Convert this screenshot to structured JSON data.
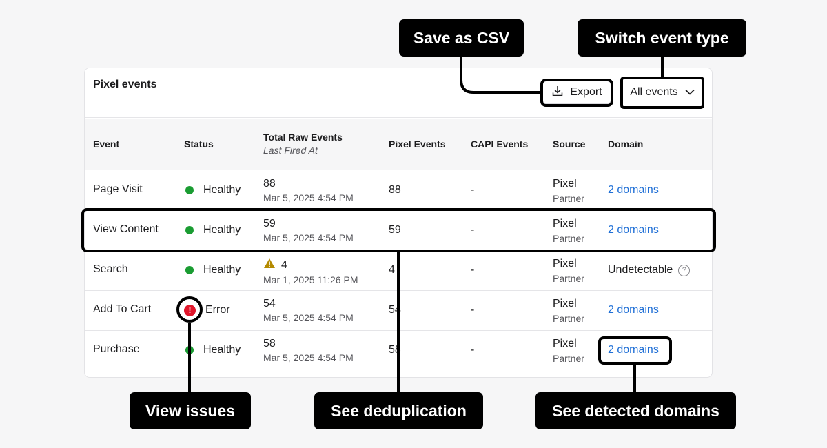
{
  "card": {
    "title": "Pixel events",
    "export_label": "Export",
    "filter_label": "All events"
  },
  "columns": {
    "event": "Event",
    "status": "Status",
    "raw": "Total Raw Events",
    "raw_sub": "Last Fired At",
    "pixel": "Pixel Events",
    "capi": "CAPI Events",
    "source": "Source",
    "domain": "Domain"
  },
  "rows": [
    {
      "event": "Page Visit",
      "status": "Healthy",
      "raw": "88",
      "date": "Mar 5, 2025 4:54 PM",
      "pixel": "88",
      "capi": "-",
      "source": "Pixel",
      "partner": "Partner",
      "domain": "2 domains"
    },
    {
      "event": "View Content",
      "status": "Healthy",
      "raw": "59",
      "date": "Mar 5, 2025 4:54 PM",
      "pixel": "59",
      "capi": "-",
      "source": "Pixel",
      "partner": "Partner",
      "domain": "2 domains"
    },
    {
      "event": "Search",
      "status": "Healthy",
      "raw": "4",
      "date": "Mar 1, 2025 11:26 PM",
      "pixel": "4",
      "capi": "-",
      "source": "Pixel",
      "partner": "Partner",
      "domain": "Undetectable"
    },
    {
      "event": "Add To Cart",
      "status": "Error",
      "raw": "54",
      "date": "Mar 5, 2025 4:54 PM",
      "pixel": "54",
      "capi": "-",
      "source": "Pixel",
      "partner": "Partner",
      "domain": "2 domains"
    },
    {
      "event": "Purchase",
      "status": "Healthy",
      "raw": "58",
      "date": "Mar 5, 2025 4:54 PM",
      "pixel": "58",
      "capi": "-",
      "source": "Pixel",
      "partner": "Partner",
      "domain": "2 domains"
    }
  ],
  "annotations": {
    "save_csv": "Save as CSV",
    "switch_event": "Switch event type",
    "view_issues": "View issues",
    "see_dedup": "See deduplication",
    "see_domains": "See detected domains"
  },
  "colors": {
    "healthy": "#1a9c32",
    "error": "#e0162b",
    "warning": "#b48a00",
    "link": "#1f6fd6"
  },
  "icons": {
    "export": "download-icon",
    "filter": "chevron-down-icon",
    "healthy": "status-dot-icon",
    "error": "error-alert-icon",
    "warning": "warning-triangle-icon",
    "help": "help-circle-icon"
  }
}
